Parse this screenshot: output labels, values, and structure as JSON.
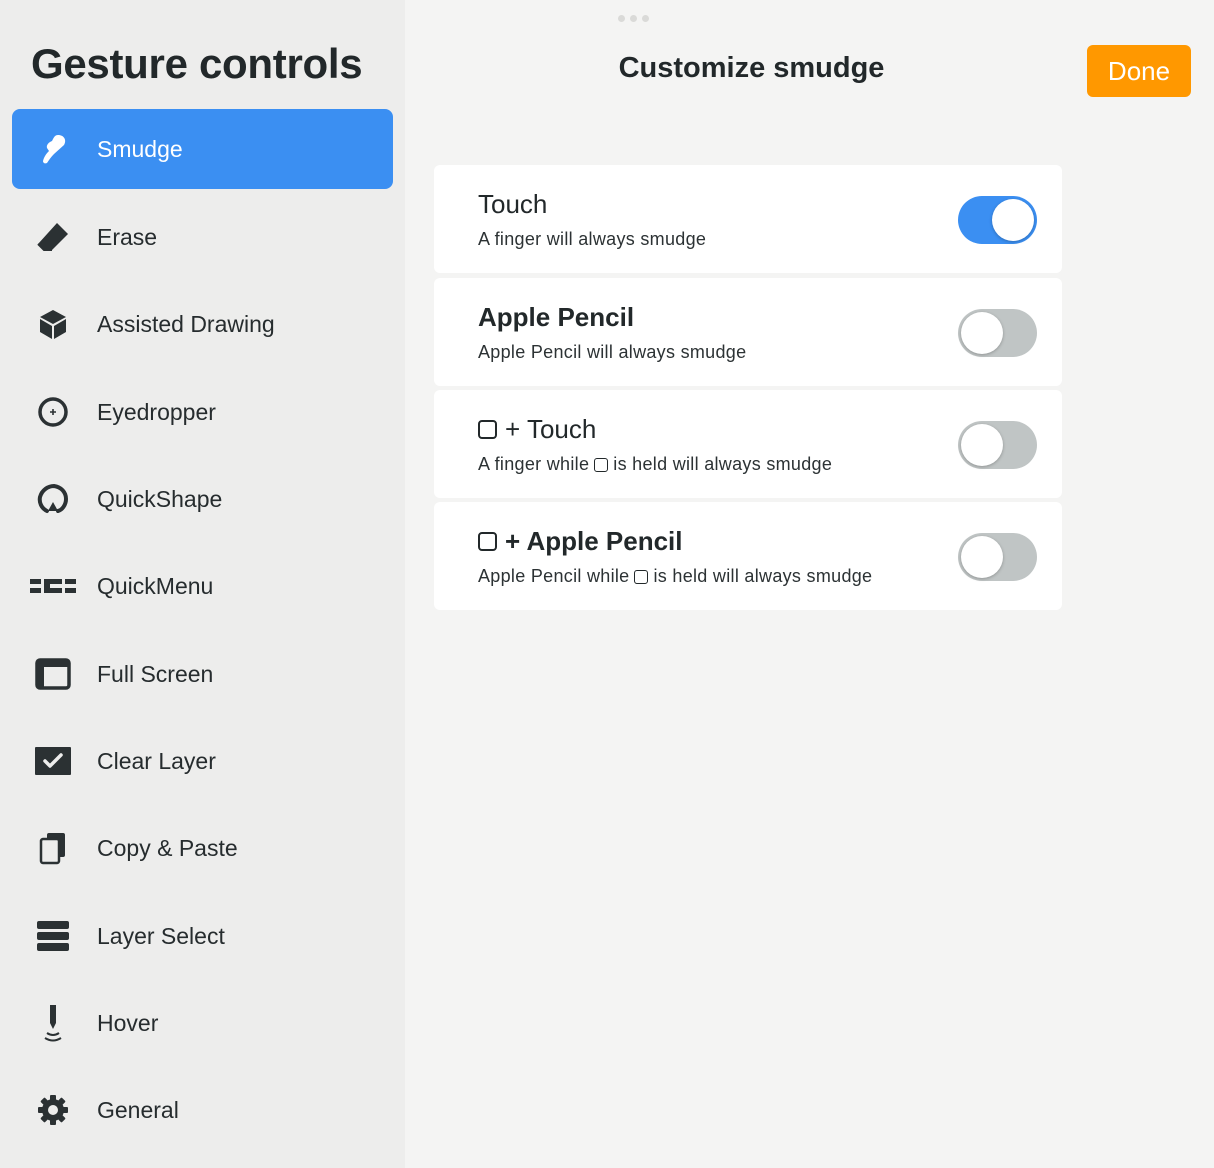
{
  "sidebar": {
    "title": "Gesture controls",
    "items": [
      {
        "label": "Smudge",
        "icon": "smudge-finger-icon",
        "active": true
      },
      {
        "label": "Erase",
        "icon": "eraser-icon",
        "active": false
      },
      {
        "label": "Assisted Drawing",
        "icon": "cube-icon",
        "active": false
      },
      {
        "label": "Eyedropper",
        "icon": "eyedropper-icon",
        "active": false
      },
      {
        "label": "QuickShape",
        "icon": "quickshape-icon",
        "active": false
      },
      {
        "label": "QuickMenu",
        "icon": "quickmenu-icon",
        "active": false
      },
      {
        "label": "Full Screen",
        "icon": "full-screen-icon",
        "active": false
      },
      {
        "label": "Clear Layer",
        "icon": "checkbox-icon",
        "active": false
      },
      {
        "label": "Copy & Paste",
        "icon": "copy-icon",
        "active": false
      },
      {
        "label": "Layer Select",
        "icon": "layers-icon",
        "active": false
      },
      {
        "label": "Hover",
        "icon": "hover-pencil-icon",
        "active": false
      },
      {
        "label": "General",
        "icon": "gear-icon",
        "active": false
      }
    ]
  },
  "main": {
    "title": "Customize smudge",
    "done_label": "Done",
    "options": [
      {
        "title": "Touch",
        "description": "A finger will always smudge",
        "enabled": true
      },
      {
        "title": "Apple Pencil",
        "description": "Apple Pencil will always smudge",
        "enabled": false
      },
      {
        "title": "+ Touch",
        "desc_before": "A finger while",
        "desc_after": "is held will always smudge",
        "enabled": false
      },
      {
        "title": "+ Apple Pencil",
        "desc_before": "Apple Pencil while",
        "desc_after": "is held will always smudge",
        "enabled": false
      }
    ]
  },
  "colors": {
    "accent": "#3b8ff2",
    "done": "#ff9800",
    "toggle_off": "#c0c5c5",
    "sidebar_bg": "#ededec",
    "main_bg": "#f4f4f3"
  }
}
